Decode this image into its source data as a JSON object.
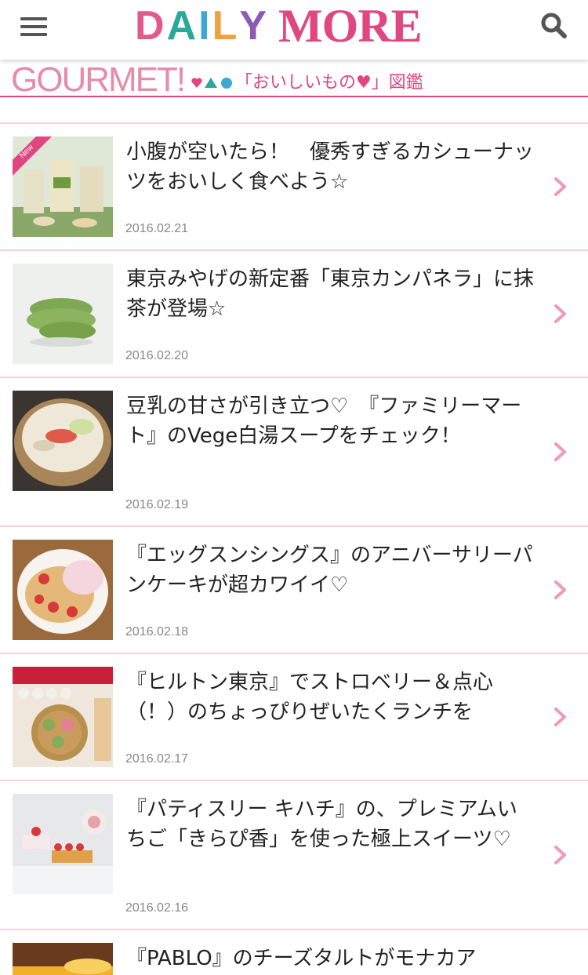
{
  "header": {
    "logo_daily": "DAILY",
    "logo_more": "MORE",
    "logo_daily_colors": [
      "#e05a8a",
      "#2aa89a",
      "#3fa7d6",
      "#f0a040",
      "#8c5ab4"
    ]
  },
  "category": {
    "title": "GOURMET!",
    "subtitle": "「おいしいもの♥」図鑑",
    "accent": "#e0467f"
  },
  "articles": [
    {
      "title": "小腹が空いたら！　優秀すぎるカシューナッツをおいしく食べよう☆",
      "date": "2016.02.21",
      "badge": "New"
    },
    {
      "title": "東京みやげの新定番「東京カンパネラ」に抹茶が登場☆",
      "date": "2016.02.20"
    },
    {
      "title": "豆乳の甘さが引き立つ♡　『ファミリーマート』のVege白湯スープをチェック！",
      "date": "2016.02.19"
    },
    {
      "title": "『エッグスンシングス』のアニバーサリーパンケーキが超カワイイ♡",
      "date": "2016.02.18"
    },
    {
      "title": "『ヒルトン東京』でストロベリー＆点心（！）のちょっぴりぜいたくランチを",
      "date": "2016.02.17"
    },
    {
      "title": "『パティスリー キハチ』の、プレミアムいちご「きらぴ香」を使った極上スイーツ♡",
      "date": "2016.02.16"
    },
    {
      "title": "『PABLO』のチーズタルトがモナカア",
      "date": ""
    }
  ]
}
